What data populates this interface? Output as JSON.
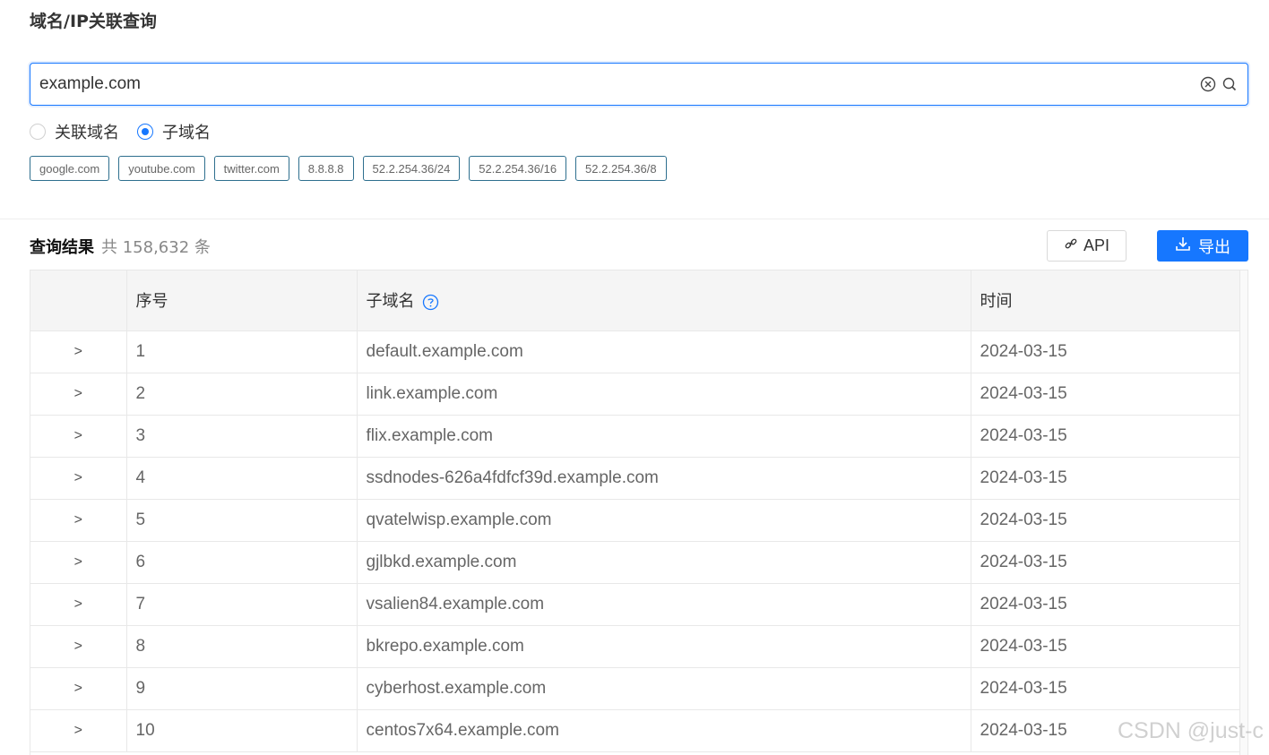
{
  "page": {
    "title": "域名/IP关联查询"
  },
  "search": {
    "value": "example.com"
  },
  "radios": [
    {
      "label": "关联域名",
      "checked": false
    },
    {
      "label": "子域名",
      "checked": true
    }
  ],
  "tags": [
    "google.com",
    "youtube.com",
    "twitter.com",
    "8.8.8.8",
    "52.2.254.36/24",
    "52.2.254.36/16",
    "52.2.254.36/8"
  ],
  "results": {
    "title": "查询结果",
    "count_text": "共 158,632 条",
    "api_label": "API",
    "export_label": "导出"
  },
  "table": {
    "columns": [
      "",
      "序号",
      "子域名",
      "时间"
    ],
    "expand_symbol": ">",
    "rows": [
      {
        "index": "1",
        "subdomain": "default.example.com",
        "time": "2024-03-15"
      },
      {
        "index": "2",
        "subdomain": "link.example.com",
        "time": "2024-03-15"
      },
      {
        "index": "3",
        "subdomain": "flix.example.com",
        "time": "2024-03-15"
      },
      {
        "index": "4",
        "subdomain": "ssdnodes-626a4fdfcf39d.example.com",
        "time": "2024-03-15"
      },
      {
        "index": "5",
        "subdomain": "qvatelwisp.example.com",
        "time": "2024-03-15"
      },
      {
        "index": "6",
        "subdomain": "gjlbkd.example.com",
        "time": "2024-03-15"
      },
      {
        "index": "7",
        "subdomain": "vsalien84.example.com",
        "time": "2024-03-15"
      },
      {
        "index": "8",
        "subdomain": "bkrepo.example.com",
        "time": "2024-03-15"
      },
      {
        "index": "9",
        "subdomain": "cyberhost.example.com",
        "time": "2024-03-15"
      },
      {
        "index": "10",
        "subdomain": "centos7x64.example.com",
        "time": "2024-03-15"
      }
    ]
  },
  "watermark": "CSDN @just-c",
  "colors": {
    "primary": "#1677ff",
    "tag_border": "#2e6f8e",
    "header_bg": "#f5f5f5"
  },
  "icons": {
    "clear": "clear-circle-icon",
    "search": "search-icon",
    "link": "link-icon",
    "download": "download-icon",
    "help": "question-circle-icon"
  }
}
